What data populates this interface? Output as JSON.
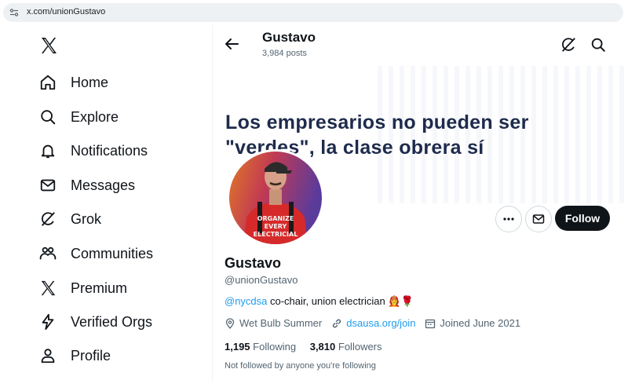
{
  "browser": {
    "url": "x.com/unionGustavo"
  },
  "sidebar": {
    "items": [
      {
        "label": "Home",
        "icon": "home-icon"
      },
      {
        "label": "Explore",
        "icon": "search-icon"
      },
      {
        "label": "Notifications",
        "icon": "bell-icon"
      },
      {
        "label": "Messages",
        "icon": "mail-icon"
      },
      {
        "label": "Grok",
        "icon": "grok-icon"
      },
      {
        "label": "Communities",
        "icon": "people-icon"
      },
      {
        "label": "Premium",
        "icon": "x-logo-icon"
      },
      {
        "label": "Verified Orgs",
        "icon": "lightning-icon"
      },
      {
        "label": "Profile",
        "icon": "person-icon"
      }
    ]
  },
  "header": {
    "name": "Gustavo",
    "posts": "3,984 posts"
  },
  "banner": {
    "line1": "Los empresarios no pueden ser",
    "line2": "\"verdes\", la clase obrera sí"
  },
  "avatar": {
    "shirt_text1": "ORGANIZE",
    "shirt_text2": "EVERY",
    "shirt_text3": "ELECTRICIAL"
  },
  "actions": {
    "follow_label": "Follow"
  },
  "profile": {
    "name": "Gustavo",
    "handle": "@unionGustavo",
    "bio_mention": "@nycdsa",
    "bio_text": " co-chair, union electrician 👩‍🚒🌹",
    "location": "Wet Bulb Summer",
    "website": "dsausa.org/join",
    "joined": "Joined June 2021",
    "following_count": "1,195",
    "following_label": "Following",
    "followers_count": "3,810",
    "followers_label": "Followers",
    "followed_note": "Not followed by anyone you're following"
  },
  "colors": {
    "accent": "#1d9bf0",
    "text": "#0f1419",
    "muted": "#536471",
    "banner_text": "#1e2b4c"
  }
}
